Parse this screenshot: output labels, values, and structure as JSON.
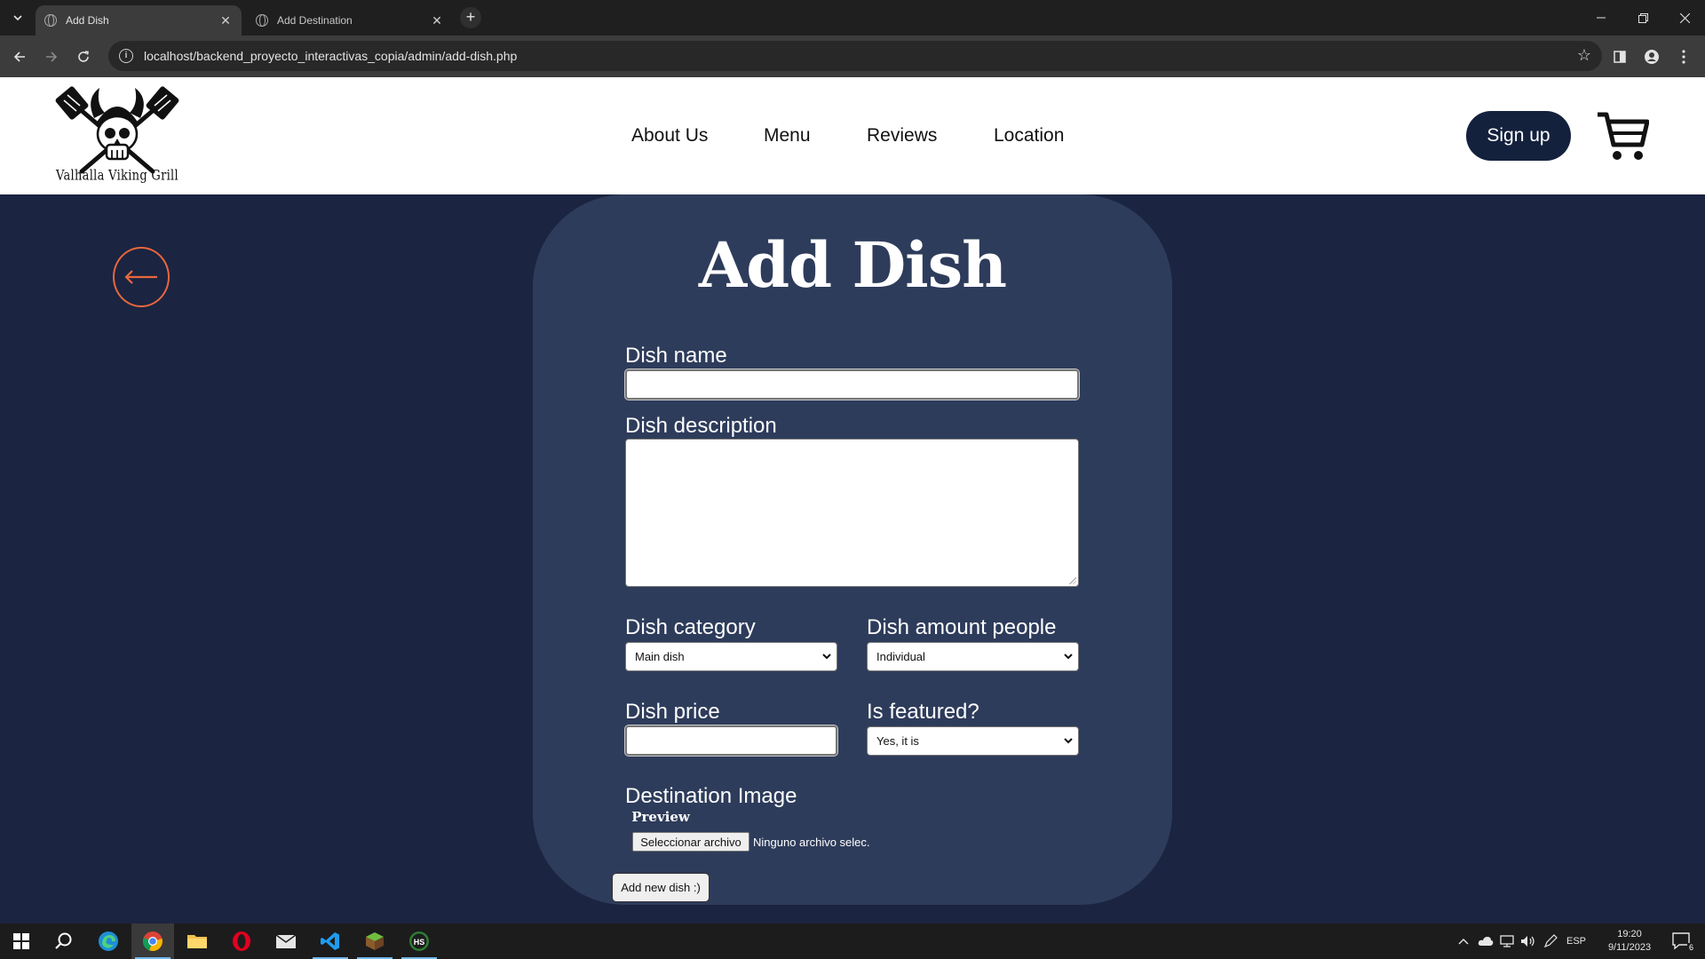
{
  "browser": {
    "tabs": [
      {
        "title": "Add Dish",
        "active": true
      },
      {
        "title": "Add Destination",
        "active": false
      }
    ],
    "url": "localhost/backend_proyecto_interactivas_copia/admin/add-dish.php"
  },
  "site": {
    "logo_text": "Valhalla Viking Grill",
    "nav": [
      "About Us",
      "Menu",
      "Reviews",
      "Location"
    ],
    "signup_label": "Sign up"
  },
  "form": {
    "title": "Add Dish",
    "name_label": "Dish name",
    "name_value": "",
    "description_label": "Dish description",
    "description_value": "",
    "category_label": "Dish category",
    "category_selected": "Main dish",
    "amount_label": "Dish amount people",
    "amount_selected": "Individual",
    "price_label": "Dish price",
    "price_value": "",
    "featured_label": "Is featured?",
    "featured_selected": "Yes, it is",
    "image_label": "Destination Image",
    "preview_alt": "Preview",
    "file_button": "Seleccionar archivo",
    "file_status": "Ninguno archivo selec.",
    "submit_label": "Add new dish :)"
  },
  "taskbar": {
    "apps": [
      "windows-start",
      "search",
      "edge",
      "chrome",
      "file-explorer",
      "opera",
      "mail",
      "vscode",
      "minecraft",
      "hs-app"
    ],
    "language": "ESP",
    "time": "19:20",
    "date": "9/11/2023",
    "notification_count": "6"
  },
  "colors": {
    "page_bg": "#1b2440",
    "panel_bg": "#2e3c5b",
    "accent_orange": "#e8673f",
    "signup_bg": "#14213d"
  }
}
